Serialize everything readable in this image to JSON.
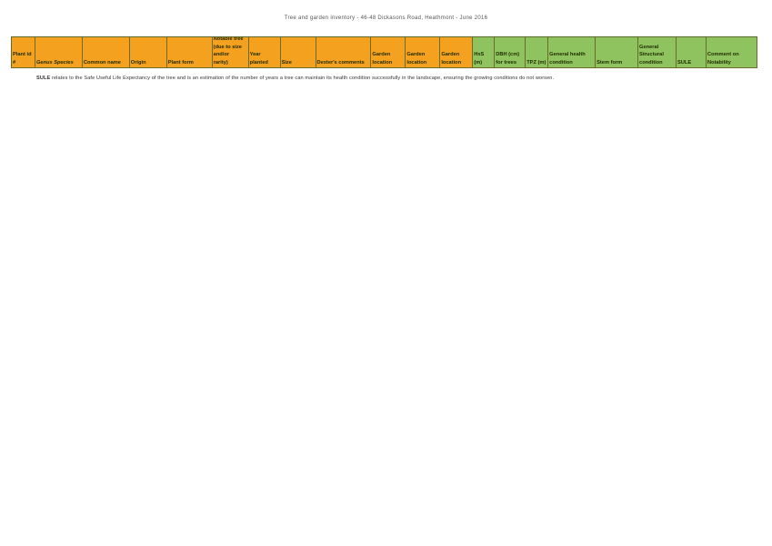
{
  "document": {
    "title": "Tree and garden inventory - 46-48 Dickasons Road, Heathmont - June 2016"
  },
  "table": {
    "columns": [
      {
        "label": "Plant id\n#",
        "color": "orange",
        "width": 26
      },
      {
        "label": "Genus Species",
        "color": "orange",
        "width": 52,
        "italic": true
      },
      {
        "label": "Common name",
        "color": "orange",
        "width": 52
      },
      {
        "label": "Origin",
        "color": "orange",
        "width": 41
      },
      {
        "label": "Plant form",
        "color": "orange",
        "width": 50
      },
      {
        "label": "Notable tree\n(due to size\nand/or\nrarity)",
        "color": "orange",
        "width": 40
      },
      {
        "label": "Year\nplanted",
        "color": "orange",
        "width": 35
      },
      {
        "label": "Size",
        "color": "orange",
        "width": 39
      },
      {
        "label": "Dexter's comments",
        "color": "orange",
        "width": 61
      },
      {
        "label": "Garden\nlocation",
        "color": "orange",
        "width": 38
      },
      {
        "label": "Garden\nlocation",
        "color": "orange",
        "width": 38
      },
      {
        "label": "Garden\nlocation",
        "color": "orange",
        "width": 36
      },
      {
        "label": "HxS (m)",
        "color": "green",
        "width": 24
      },
      {
        "label": "DBH (cm)\nfor trees",
        "color": "green",
        "width": 34
      },
      {
        "label": "TPZ (m)",
        "color": "green",
        "width": 25
      },
      {
        "label": "General health\ncondition",
        "color": "green",
        "width": 52
      },
      {
        "label": "Stem form",
        "color": "green",
        "width": 47
      },
      {
        "label": "General\nStructural\ncondition",
        "color": "green",
        "width": 42
      },
      {
        "label": "SULE",
        "color": "green",
        "width": 33
      },
      {
        "label": "Comment on\nNotability",
        "color": "green",
        "width": 56
      }
    ]
  },
  "note": {
    "term": "SULE",
    "text": " relates to the Safe Useful Life Expectancy of the tree and is an estimation of the number of years a tree can maintain its health condition successfully in the landscape, ensuring the growing conditions do not worsen."
  }
}
